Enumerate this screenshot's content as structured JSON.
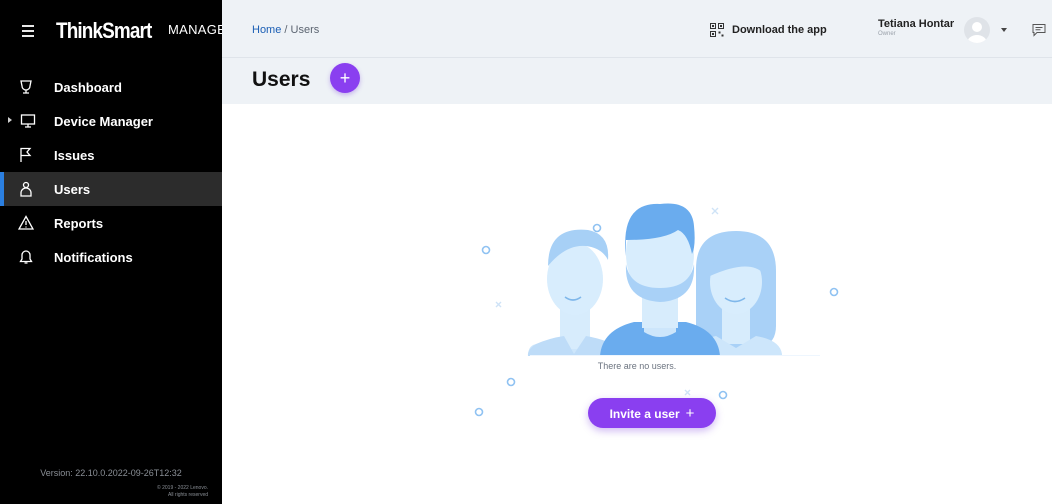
{
  "sidebar": {
    "brand_main": "ThinkSmart",
    "brand_sub": "MANAGER",
    "items": [
      {
        "label": "Dashboard"
      },
      {
        "label": "Device Manager"
      },
      {
        "label": "Issues"
      },
      {
        "label": "Users"
      },
      {
        "label": "Reports"
      },
      {
        "label": "Notifications"
      }
    ],
    "version": "Version: 22.10.0.2022-09-26T12:32",
    "copyright_line1": "© 2019 - 2022 Lenovo.",
    "copyright_line2": "All rights reserved"
  },
  "topbar": {
    "breadcrumb_home": "Home",
    "breadcrumb_sep": " / ",
    "breadcrumb_current": "Users",
    "download_label": "Download the app",
    "user_name": "Tetiana Hontar",
    "user_role": "Owner"
  },
  "page": {
    "title": "Users",
    "add_label": "+",
    "empty_message": "There are no users.",
    "invite_label": "Invite a user",
    "invite_plus": "+"
  },
  "colors": {
    "sidebar_bg": "#000000",
    "active_indicator": "#2b7fe0",
    "accent_purple": "#8a3ff0",
    "topbar_bg": "#eef2f6",
    "illustration_blue": "#a9d1f7"
  },
  "icons": {
    "menu": "hamburger-icon",
    "dashboard": "trophy-icon",
    "device_manager": "monitor-icon",
    "issues": "flag-icon",
    "users": "user-icon",
    "reports": "warning-icon",
    "notifications": "bell-icon",
    "download": "qr-code-icon",
    "chat": "chat-icon"
  }
}
